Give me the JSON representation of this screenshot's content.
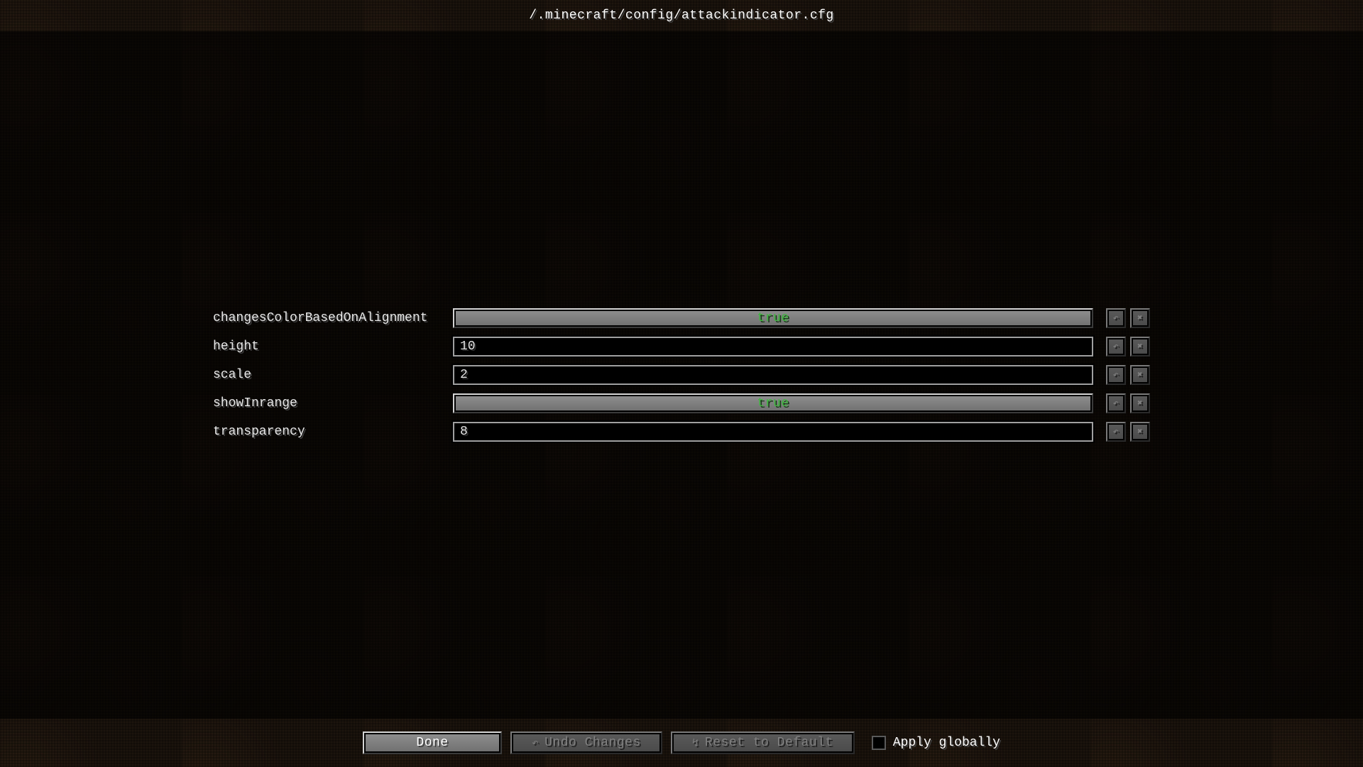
{
  "title": "/.minecraft/config/attackindicator.cfg",
  "settings": [
    {
      "key": "changesColorBasedOnAlignment",
      "type": "bool",
      "value": "true"
    },
    {
      "key": "height",
      "type": "text",
      "value": "10"
    },
    {
      "key": "scale",
      "type": "text",
      "value": "2"
    },
    {
      "key": "showInrange",
      "type": "bool",
      "value": "true"
    },
    {
      "key": "transparency",
      "type": "text",
      "value": "8"
    }
  ],
  "row_icons": {
    "undo": "↶",
    "reset": "✖"
  },
  "bottom": {
    "done": "Done",
    "undo": "Undo Changes",
    "reset": "Reset to Default",
    "apply_globally": "Apply globally",
    "apply_globally_checked": false
  }
}
